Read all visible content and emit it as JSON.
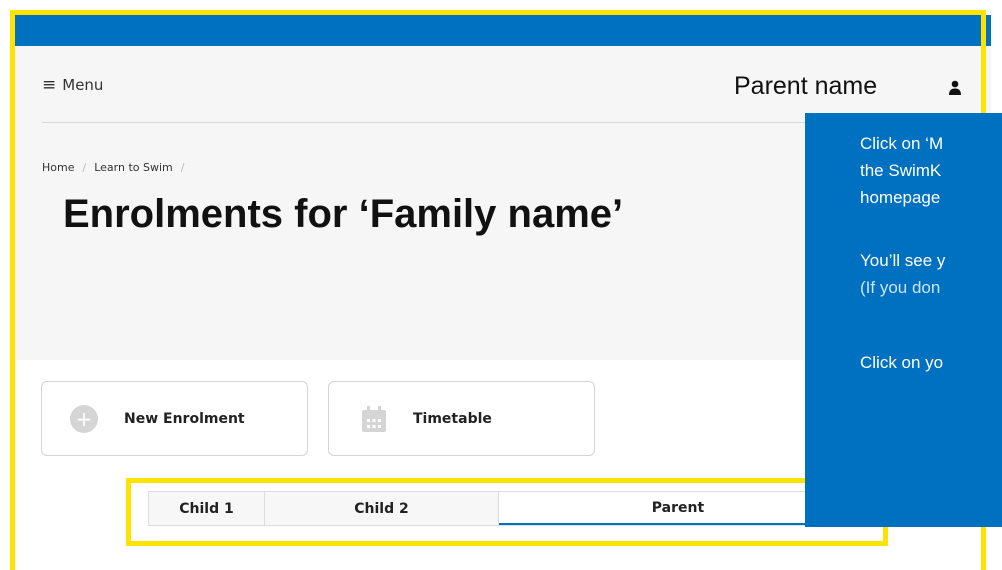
{
  "header": {
    "menu_label": "Menu",
    "parent_name": "Parent name"
  },
  "breadcrumb": {
    "items": [
      "Home",
      "Learn to Swim"
    ],
    "separator": "/"
  },
  "page_title": "Enrolments for ‘Family name’",
  "actions": {
    "new_enrolment": "New Enrolment",
    "timetable": "Timetable"
  },
  "tabs": [
    "Child 1",
    "Child 2",
    "Parent"
  ],
  "callout": {
    "line1": "Click on ‘M",
    "line2": "the SwimK",
    "line3": "homepage",
    "line4": "You’ll see y",
    "line5": "(If you don",
    "line6": "Click on yo"
  },
  "colors": {
    "brand_blue": "#0070c0",
    "highlight_yellow": "#ffe200"
  }
}
